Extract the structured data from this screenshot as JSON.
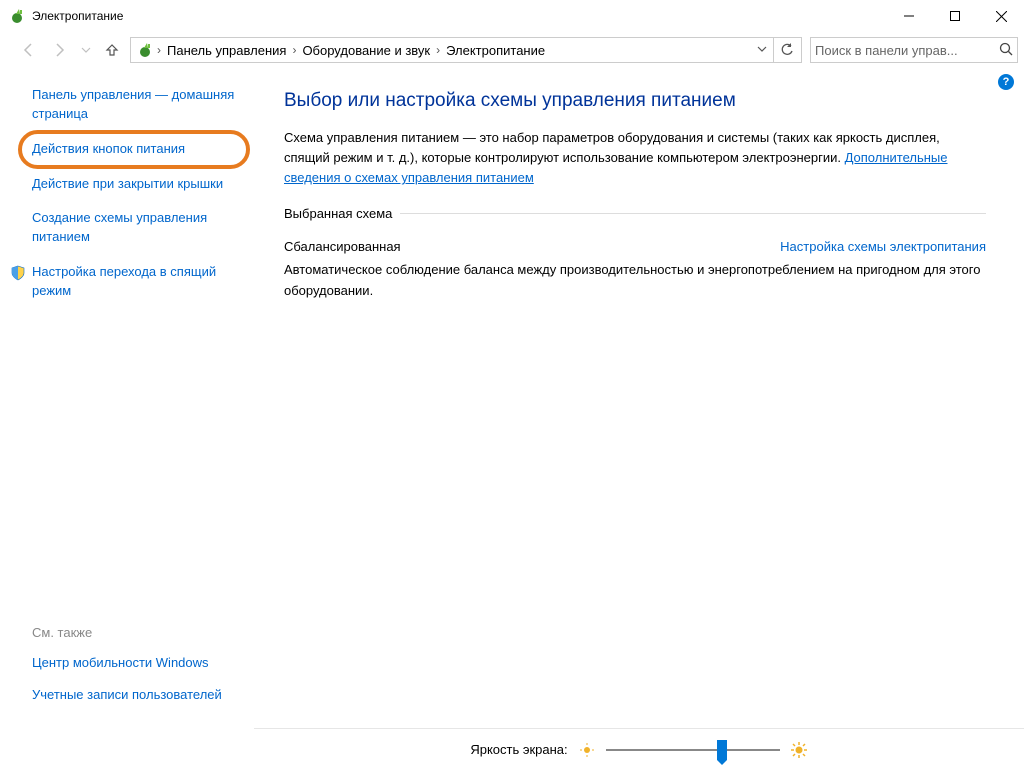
{
  "titlebar": {
    "title": "Электропитание"
  },
  "breadcrumbs": {
    "items": [
      "Панель управления",
      "Оборудование и звук",
      "Электропитание"
    ]
  },
  "search": {
    "placeholder": "Поиск в панели управ..."
  },
  "sidebar": {
    "home": "Панель управления — домашняя страница",
    "items": [
      {
        "label": "Действия кнопок питания",
        "highlighted": true
      },
      {
        "label": "Действие при закрытии крышки"
      },
      {
        "label": "Создание схемы управления питанием"
      },
      {
        "label": "Настройка перехода в спящий режим",
        "shield": true
      }
    ]
  },
  "see_also": {
    "heading": "См. также",
    "items": [
      "Центр мобильности Windows",
      "Учетные записи пользователей"
    ]
  },
  "main": {
    "heading": "Выбор или настройка схемы управления питанием",
    "intro": "Схема управления питанием — это набор параметров оборудования и системы (таких как яркость дисплея, спящий режим и т. д.), которые контролируют использование компьютером электроэнергии. ",
    "intro_link": "Дополнительные сведения о схемах управления питанием",
    "selected_heading": "Выбранная схема",
    "plan_name": "Сбалансированная",
    "plan_link": "Настройка схемы электропитания",
    "plan_desc": "Автоматическое соблюдение баланса между производительностью и энергопотреблением на пригодном для этого оборудовании."
  },
  "bottom": {
    "label": "Яркость экрана:"
  }
}
